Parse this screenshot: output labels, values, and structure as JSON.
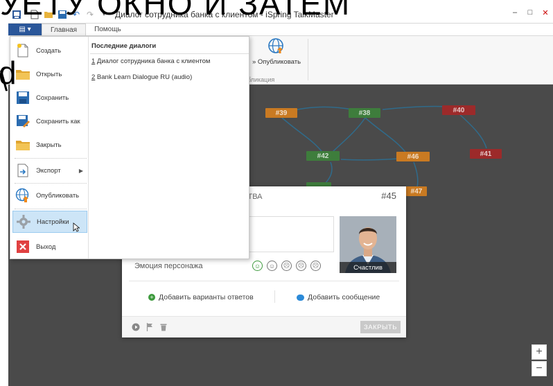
{
  "overlay": {
    "top_text": "УЕТУ ОКНО И ЗАТЕМ",
    "side_text_1": "d",
    "side_text_2": "\\"
  },
  "window": {
    "title": "Диалог сотрудника банка с клиентом - iSpring TalkMaster",
    "quick_access": [
      "new-doc-icon",
      "open-folder-icon",
      "save-icon",
      "undo-icon",
      "redo-icon",
      "customize-icon"
    ],
    "controls": {
      "minimize": "–",
      "maximize": "□",
      "close": "✕"
    }
  },
  "ribbon": {
    "file_label": "▤ ▾",
    "tabs": [
      {
        "label": "Главная",
        "active": true
      },
      {
        "label": "Помощь",
        "active": false
      }
    ],
    "publish_label": "Опубликовать",
    "publish_prefix": "»",
    "group_label": "бликация"
  },
  "file_menu": {
    "items": [
      {
        "label": "Создать",
        "icon": "new-document-icon"
      },
      {
        "label": "Открыть",
        "icon": "folder-icon"
      },
      {
        "label": "Сохранить",
        "icon": "save-icon"
      },
      {
        "label": "Сохранить как",
        "icon": "save-as-icon"
      },
      {
        "label": "Закрыть",
        "icon": "close-folder-icon"
      },
      {
        "label": "Экспорт",
        "icon": "export-icon",
        "submenu": true
      },
      {
        "label": "Опубликовать",
        "icon": "publish-globe-icon"
      },
      {
        "label": "Настройки",
        "icon": "gear-icon",
        "hover": true
      },
      {
        "label": "Выход",
        "icon": "exit-icon"
      }
    ],
    "recent_title": "Последние диалоги",
    "recent": [
      {
        "index": "1",
        "label": " Диалог сотрудника банка с клиентом"
      },
      {
        "index": "2",
        "label": " Bank Learn Dialogue RU (audio)"
      }
    ]
  },
  "canvas": {
    "nodes": [
      {
        "label": "#39",
        "color": "orange"
      },
      {
        "label": "#38",
        "color": "green"
      },
      {
        "label": "#40",
        "color": "red"
      },
      {
        "label": "#42",
        "color": "green"
      },
      {
        "label": "#46",
        "color": "orange"
      },
      {
        "label": "#41",
        "color": "red"
      },
      {
        "label": "#47",
        "color": "orange"
      }
    ],
    "zoom_in": "+",
    "zoom_out": "−",
    "colors": {
      "background": "#4a4a4a",
      "orange": "#c97a22",
      "green": "#3e7d3c",
      "red": "#9c2a2a",
      "link": "#2d6f93"
    }
  },
  "card": {
    "header_label": "ЙСТВА",
    "number": "#45",
    "emotion_label": "Эмоция персонажа",
    "emotions": [
      "☺",
      "☺",
      "☹",
      "☹",
      "☹"
    ],
    "photo_caption": "Счастлив",
    "add_answers": "Добавить варианты ответов",
    "add_message": "Добавить сообщение",
    "close_button": "ЗАКРЫТЬ"
  }
}
